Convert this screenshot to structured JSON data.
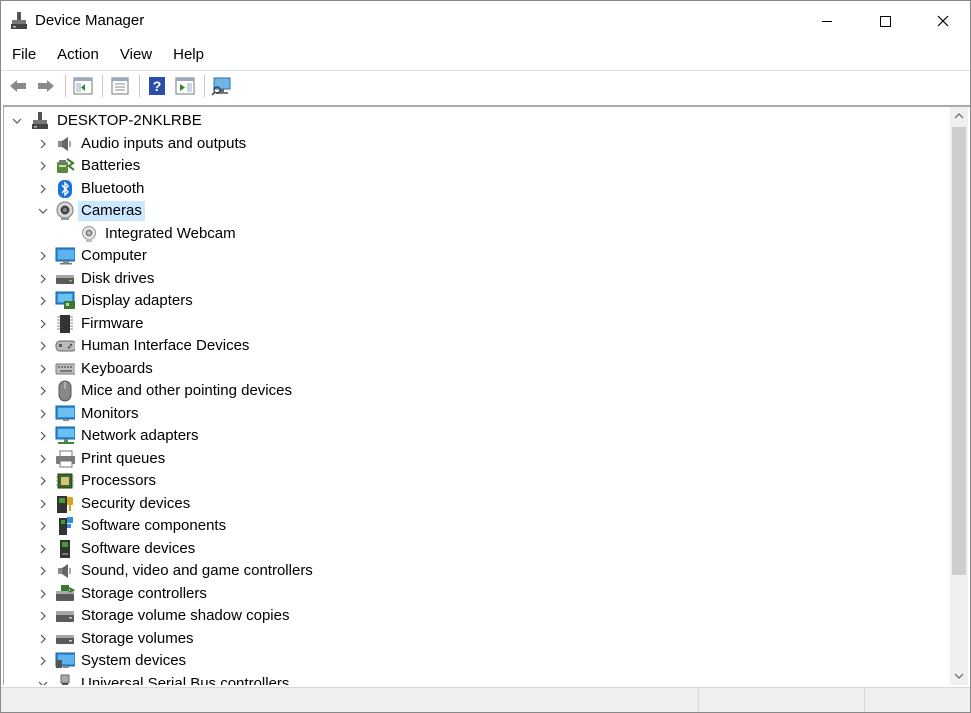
{
  "window": {
    "title": "Device Manager"
  },
  "menu": [
    "File",
    "Action",
    "View",
    "Help"
  ],
  "tree": {
    "root": "DESKTOP-2NKLRBE",
    "items": [
      {
        "label": "Audio inputs and outputs",
        "icon": "speaker-icon",
        "expanded": false
      },
      {
        "label": "Batteries",
        "icon": "battery-icon",
        "expanded": false
      },
      {
        "label": "Bluetooth",
        "icon": "bluetooth-icon",
        "expanded": false
      },
      {
        "label": "Cameras",
        "icon": "camera-icon",
        "expanded": true,
        "selected": true,
        "children": [
          {
            "label": "Integrated Webcam",
            "icon": "webcam-icon"
          }
        ]
      },
      {
        "label": "Computer",
        "icon": "computer-icon",
        "expanded": false
      },
      {
        "label": "Disk drives",
        "icon": "disk-drive-icon",
        "expanded": false
      },
      {
        "label": "Display adapters",
        "icon": "display-adapter-icon",
        "expanded": false
      },
      {
        "label": "Firmware",
        "icon": "firmware-icon",
        "expanded": false
      },
      {
        "label": "Human Interface Devices",
        "icon": "hid-icon",
        "expanded": false
      },
      {
        "label": "Keyboards",
        "icon": "keyboard-icon",
        "expanded": false
      },
      {
        "label": "Mice and other pointing devices",
        "icon": "mouse-icon",
        "expanded": false
      },
      {
        "label": "Monitors",
        "icon": "monitor-icon",
        "expanded": false
      },
      {
        "label": "Network adapters",
        "icon": "network-adapter-icon",
        "expanded": false
      },
      {
        "label": "Print queues",
        "icon": "printer-icon",
        "expanded": false
      },
      {
        "label": "Processors",
        "icon": "processor-icon",
        "expanded": false
      },
      {
        "label": "Security devices",
        "icon": "security-device-icon",
        "expanded": false
      },
      {
        "label": "Software components",
        "icon": "software-component-icon",
        "expanded": false
      },
      {
        "label": "Software devices",
        "icon": "software-device-icon",
        "expanded": false
      },
      {
        "label": "Sound, video and game controllers",
        "icon": "sound-controller-icon",
        "expanded": false
      },
      {
        "label": "Storage controllers",
        "icon": "storage-controller-icon",
        "expanded": false
      },
      {
        "label": "Storage volume shadow copies",
        "icon": "shadow-copy-icon",
        "expanded": false
      },
      {
        "label": "Storage volumes",
        "icon": "storage-volume-icon",
        "expanded": false
      },
      {
        "label": "System devices",
        "icon": "system-device-icon",
        "expanded": false
      },
      {
        "label": "Universal Serial Bus controllers",
        "icon": "usb-icon",
        "expanded": true
      }
    ]
  },
  "colors": {
    "selection": "#cce8ff",
    "scrollbar_thumb": "#cdcdcd",
    "status_bar": "#f0f0f0"
  }
}
